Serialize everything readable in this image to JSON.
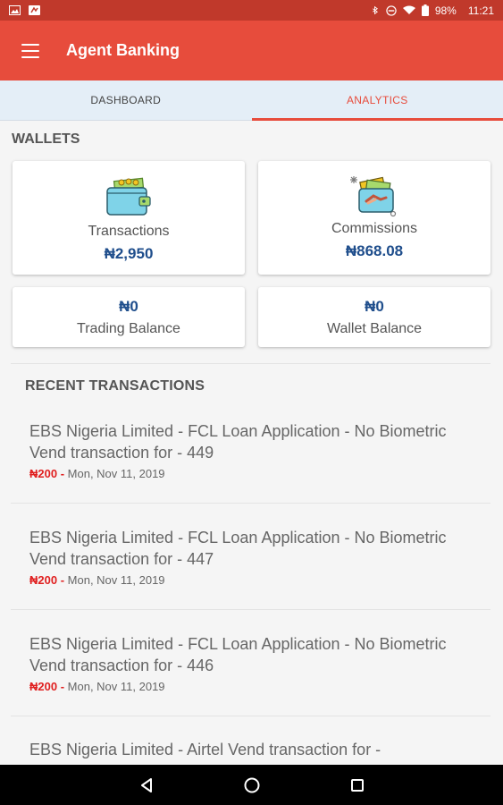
{
  "status_bar": {
    "battery": "98%",
    "time": "11:21"
  },
  "app_bar": {
    "title": "Agent Banking"
  },
  "tabs": [
    {
      "label": "DASHBOARD",
      "active": false
    },
    {
      "label": "ANALYTICS",
      "active": true
    }
  ],
  "wallets": {
    "title": "WALLETS",
    "transactions": {
      "label": "Transactions",
      "value": "₦2,950"
    },
    "commissions": {
      "label": "Commissions",
      "value": "₦868.08"
    },
    "trading": {
      "label": "Trading Balance",
      "value": "₦0"
    },
    "wallet": {
      "label": "Wallet Balance",
      "value": "₦0"
    }
  },
  "recent": {
    "title": "RECENT TRANSACTIONS",
    "items": [
      {
        "description": "EBS Nigeria Limited - FCL Loan Application - No Biometric Vend transaction for - 449",
        "amount": "₦200 -",
        "date": "Mon, Nov 11, 2019"
      },
      {
        "description": "EBS Nigeria Limited - FCL Loan Application - No Biometric Vend transaction for - 447",
        "amount": "₦200 -",
        "date": "Mon, Nov 11, 2019"
      },
      {
        "description": "EBS Nigeria Limited - FCL Loan Application - No Biometric Vend transaction for - 446",
        "amount": "₦200 -",
        "date": "Mon, Nov 11, 2019"
      },
      {
        "description": "EBS Nigeria Limited - Airtel Vend transaction for -",
        "amount": "",
        "date": ""
      }
    ]
  },
  "colors": {
    "primary": "#e74c3c",
    "status_bar": "#c0392b",
    "value_blue": "#1f4e8c",
    "amount_red": "#e02020"
  }
}
